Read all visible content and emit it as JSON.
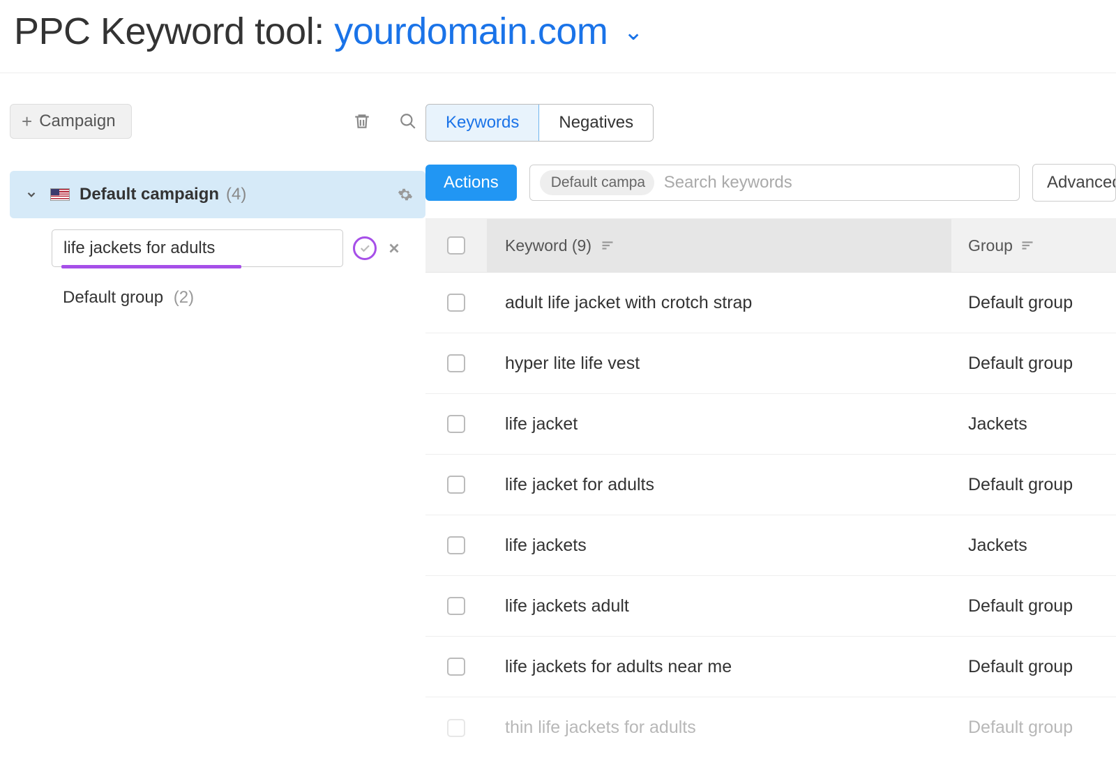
{
  "header": {
    "title_prefix": "PPC Keyword tool:",
    "domain": "yourdomain.com"
  },
  "sidebar": {
    "add_campaign_label": "Campaign",
    "campaign": {
      "name": "Default campaign",
      "count": "(4)"
    },
    "new_group_input_value": "life jackets for adults",
    "groups": [
      {
        "name": "Default group",
        "count": "(2)"
      }
    ]
  },
  "main": {
    "tabs": {
      "keywords": "Keywords",
      "negatives": "Negatives"
    },
    "actions_label": "Actions",
    "search_chip": "Default campa",
    "search_placeholder": "Search keywords",
    "advanced_label": "Advanced",
    "table": {
      "header_keyword": "Keyword (9)",
      "header_group": "Group",
      "rows": [
        {
          "keyword": "adult life jacket with crotch strap",
          "group": "Default group"
        },
        {
          "keyword": "hyper lite life vest",
          "group": "Default group"
        },
        {
          "keyword": "life jacket",
          "group": "Jackets"
        },
        {
          "keyword": "life jacket for adults",
          "group": "Default group"
        },
        {
          "keyword": "life jackets",
          "group": "Jackets"
        },
        {
          "keyword": "life jackets adult",
          "group": "Default group"
        },
        {
          "keyword": "life jackets for adults near me",
          "group": "Default group"
        },
        {
          "keyword": "thin life jackets for adults",
          "group": "Default group"
        }
      ]
    }
  }
}
